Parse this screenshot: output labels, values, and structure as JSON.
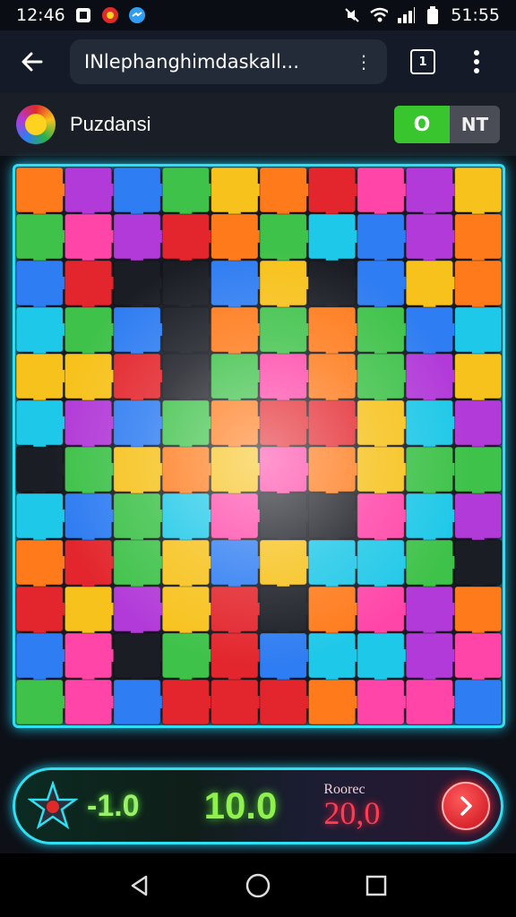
{
  "status_bar": {
    "time": "12:46",
    "clock_right": "51:55",
    "icons_left": [
      "notification-icon",
      "app-badge-icon",
      "messenger-icon"
    ],
    "icons_right": [
      "mute-icon",
      "wifi-icon",
      "signal-icon",
      "battery-icon"
    ]
  },
  "browser": {
    "url": "INlephanghimdaskall...",
    "url_more": "⋮",
    "tab_count": "1"
  },
  "app": {
    "title": "Puzdansi",
    "toggle_on_label": "O",
    "toggle_label": "NT"
  },
  "puzzle": {
    "colors": [
      "#e3262d",
      "#2f7df2",
      "#3fc24a",
      "#f7c21b",
      "#ff7a1a",
      "#b23ad8",
      "#1ec8e8",
      "#ff45a8",
      "#1a1d24"
    ]
  },
  "score_bar": {
    "left_score": "-1.0",
    "main_score": "10.0",
    "record_label": "Roorec",
    "record_value": "20,0"
  },
  "colors": {
    "accent": "#2ee0f2",
    "toggle_green": "#39c52e",
    "score_green": "#8ff04f",
    "record_red": "#ff3c52"
  }
}
